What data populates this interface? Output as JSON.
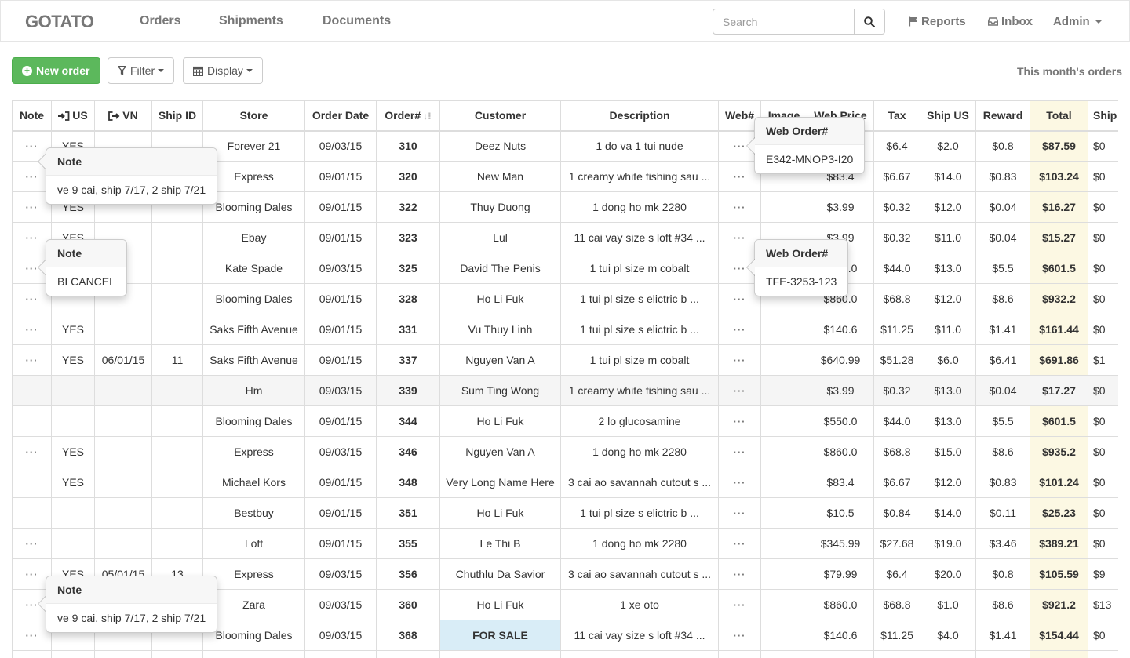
{
  "navbar": {
    "brand": "GOTATO",
    "links": [
      "Orders",
      "Shipments",
      "Documents"
    ],
    "search_placeholder": "Search",
    "reports": "Reports",
    "inbox": "Inbox",
    "admin": "Admin"
  },
  "toolbar": {
    "new_order": "New order",
    "filter": "Filter",
    "display": "Display",
    "month_label": "This month's orders"
  },
  "table": {
    "headers": [
      "Note",
      "US",
      "VN",
      "Ship ID",
      "Store",
      "Order Date",
      "Order#",
      "Customer",
      "Description",
      "Web#",
      "Image",
      "Web Price",
      "Tax",
      "Ship US",
      "Reward",
      "Total",
      "Ship"
    ],
    "rows": [
      {
        "note": "···",
        "us": "YES",
        "vn": "",
        "ship_id": "",
        "store": "Forever 21",
        "date": "09/03/15",
        "order": "310",
        "customer": "Deez Nuts",
        "desc": "1 do va 1 tui nude",
        "web": "···",
        "image": "",
        "price": "",
        "tax": "$6.4",
        "ship_us": "$2.0",
        "reward": "$0.8",
        "total": "$87.59",
        "ship": "$0"
      },
      {
        "note": "···",
        "us": "",
        "vn": "",
        "ship_id": "",
        "store": "Express",
        "date": "09/01/15",
        "order": "320",
        "customer": "New Man",
        "desc": "1 creamy white fishing sau ...",
        "web": "···",
        "image": "",
        "price": "$83.4",
        "tax": "$6.67",
        "ship_us": "$14.0",
        "reward": "$0.83",
        "total": "$103.24",
        "ship": "$0"
      },
      {
        "note": "···",
        "us": "YES",
        "vn": "",
        "ship_id": "",
        "store": "Blooming Dales",
        "date": "09/01/15",
        "order": "322",
        "customer": "Thuy Duong",
        "desc": "1 dong ho mk 2280",
        "web": "···",
        "image": "",
        "price": "$3.99",
        "tax": "$0.32",
        "ship_us": "$12.0",
        "reward": "$0.04",
        "total": "$16.27",
        "ship": "$0"
      },
      {
        "note": "···",
        "us": "YES",
        "vn": "",
        "ship_id": "",
        "store": "Ebay",
        "date": "09/01/15",
        "order": "323",
        "customer": "Lul",
        "desc": "11 cai vay size s loft #34 ...",
        "web": "···",
        "image": "",
        "price": "$3.99",
        "tax": "$0.32",
        "ship_us": "$11.0",
        "reward": "$0.04",
        "total": "$15.27",
        "ship": "$0"
      },
      {
        "note": "···",
        "us": "",
        "vn": "",
        "ship_id": "",
        "store": "Kate Spade",
        "date": "09/03/15",
        "order": "325",
        "customer": "David The Penis",
        "desc": "1 tui pl size m cobalt",
        "web": "···",
        "image": "",
        "price": "$550.0",
        "tax": "$44.0",
        "ship_us": "$13.0",
        "reward": "$5.5",
        "total": "$601.5",
        "ship": "$0"
      },
      {
        "note": "···",
        "us": "",
        "vn": "",
        "ship_id": "",
        "store": "Blooming Dales",
        "date": "09/01/15",
        "order": "328",
        "customer": "Ho Li Fuk",
        "desc": "1 tui pl size s elictric b ...",
        "web": "···",
        "image": "",
        "price": "$860.0",
        "tax": "$68.8",
        "ship_us": "$12.0",
        "reward": "$8.6",
        "total": "$932.2",
        "ship": "$0"
      },
      {
        "note": "···",
        "us": "YES",
        "vn": "",
        "ship_id": "",
        "store": "Saks Fifth Avenue",
        "date": "09/01/15",
        "order": "331",
        "customer": "Vu Thuy Linh",
        "desc": "1 tui pl size s elictric b ...",
        "web": "···",
        "image": "",
        "price": "$140.6",
        "tax": "$11.25",
        "ship_us": "$11.0",
        "reward": "$1.41",
        "total": "$161.44",
        "ship": "$0"
      },
      {
        "note": "···",
        "us": "YES",
        "vn": "06/01/15",
        "ship_id": "11",
        "store": "Saks Fifth Avenue",
        "date": "09/01/15",
        "order": "337",
        "customer": "Nguyen Van A",
        "desc": "1 tui pl size m cobalt",
        "web": "···",
        "image": "",
        "price": "$640.99",
        "tax": "$51.28",
        "ship_us": "$6.0",
        "reward": "$6.41",
        "total": "$691.86",
        "ship": "$1"
      },
      {
        "note": "",
        "us": "",
        "vn": "",
        "ship_id": "",
        "store": "Hm",
        "date": "09/03/15",
        "order": "339",
        "customer": "Sum Ting Wong",
        "desc": "1 creamy white fishing sau ...",
        "web": "···",
        "image": "",
        "price": "$3.99",
        "tax": "$0.32",
        "ship_us": "$13.0",
        "reward": "$0.04",
        "total": "$17.27",
        "ship": "$0",
        "highlight": true
      },
      {
        "note": "",
        "us": "",
        "vn": "",
        "ship_id": "",
        "store": "Blooming Dales",
        "date": "09/01/15",
        "order": "344",
        "customer": "Ho Li Fuk",
        "desc": "2 lo glucosamine",
        "web": "···",
        "image": "",
        "price": "$550.0",
        "tax": "$44.0",
        "ship_us": "$13.0",
        "reward": "$5.5",
        "total": "$601.5",
        "ship": "$0"
      },
      {
        "note": "···",
        "us": "YES",
        "vn": "",
        "ship_id": "",
        "store": "Express",
        "date": "09/03/15",
        "order": "346",
        "customer": "Nguyen Van A",
        "desc": "1 dong ho mk 2280",
        "web": "···",
        "image": "",
        "price": "$860.0",
        "tax": "$68.8",
        "ship_us": "$15.0",
        "reward": "$8.6",
        "total": "$935.2",
        "ship": "$0"
      },
      {
        "note": "",
        "us": "YES",
        "vn": "",
        "ship_id": "",
        "store": "Michael Kors",
        "date": "09/01/15",
        "order": "348",
        "customer": "Very Long Name Here",
        "desc": "3 cai ao savannah cutout s ...",
        "web": "···",
        "image": "",
        "price": "$83.4",
        "tax": "$6.67",
        "ship_us": "$12.0",
        "reward": "$0.83",
        "total": "$101.24",
        "ship": "$0"
      },
      {
        "note": "",
        "us": "",
        "vn": "",
        "ship_id": "",
        "store": "Bestbuy",
        "date": "09/01/15",
        "order": "351",
        "customer": "Ho Li Fuk",
        "desc": "1 tui pl size s elictric b ...",
        "web": "···",
        "image": "",
        "price": "$10.5",
        "tax": "$0.84",
        "ship_us": "$14.0",
        "reward": "$0.11",
        "total": "$25.23",
        "ship": "$0"
      },
      {
        "note": "···",
        "us": "",
        "vn": "",
        "ship_id": "",
        "store": "Loft",
        "date": "09/01/15",
        "order": "355",
        "customer": "Le Thi B",
        "desc": "1 dong ho mk 2280",
        "web": "···",
        "image": "",
        "price": "$345.99",
        "tax": "$27.68",
        "ship_us": "$19.0",
        "reward": "$3.46",
        "total": "$389.21",
        "ship": "$0"
      },
      {
        "note": "···",
        "us": "YES",
        "vn": "05/01/15",
        "ship_id": "13",
        "store": "Express",
        "date": "09/03/15",
        "order": "356",
        "customer": "Chuthlu Da Savior",
        "desc": "3 cai ao savannah cutout s ...",
        "web": "···",
        "image": "",
        "price": "$79.99",
        "tax": "$6.4",
        "ship_us": "$20.0",
        "reward": "$0.8",
        "total": "$105.59",
        "ship": "$9"
      },
      {
        "note": "···",
        "us": "",
        "vn": "",
        "ship_id": "",
        "store": "Zara",
        "date": "09/03/15",
        "order": "360",
        "customer": "Ho Li Fuk",
        "desc": "1 xe oto",
        "web": "···",
        "image": "",
        "price": "$860.0",
        "tax": "$68.8",
        "ship_us": "$1.0",
        "reward": "$8.6",
        "total": "$921.2",
        "ship": "$13"
      },
      {
        "note": "···",
        "us": "",
        "vn": "",
        "ship_id": "",
        "store": "Blooming Dales",
        "date": "09/03/15",
        "order": "368",
        "customer": "FOR SALE",
        "desc": "11 cai vay size s loft #34 ...",
        "web": "···",
        "image": "",
        "price": "$140.6",
        "tax": "$11.25",
        "ship_us": "$4.0",
        "reward": "$1.41",
        "total": "$154.44",
        "ship": "$0",
        "customer_highlight": true
      },
      {
        "note": "",
        "us": "",
        "vn": "",
        "ship_id": "",
        "store": "",
        "date": "",
        "order": "",
        "customer": "",
        "desc": "",
        "web": "",
        "image": "",
        "price": "",
        "tax": "",
        "ship_us": "",
        "reward": "",
        "total": "",
        "ship": ""
      }
    ]
  },
  "popovers": {
    "note1": {
      "title": "Note",
      "content": "ve 9 cai, ship 7/17, 2 ship 7/21"
    },
    "note2": {
      "title": "Note",
      "content": "BI CANCEL"
    },
    "note3": {
      "title": "Note",
      "content": "ve 9 cai, ship 7/17, 2 ship 7/21"
    },
    "web1": {
      "title": "Web Order#",
      "content": "E342-MNOP3-I20"
    },
    "web2": {
      "title": "Web Order#",
      "content": "TFE-3253-123"
    }
  },
  "colors": {
    "success": "#5cb85c",
    "total_bg": "#fcf8e3",
    "highlight_row": "#f5f5f5",
    "info_bg": "#d9edf7"
  }
}
